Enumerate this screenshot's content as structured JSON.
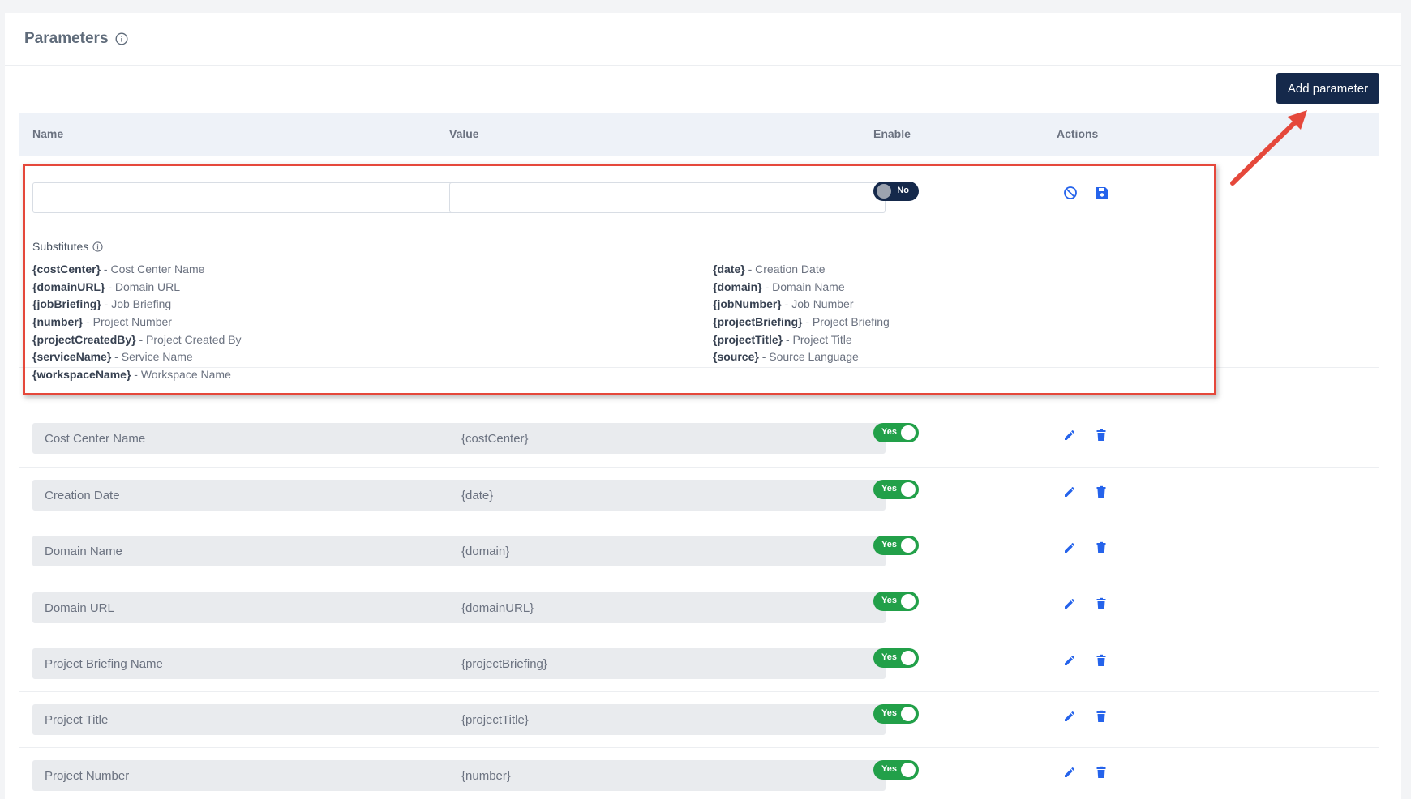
{
  "section": {
    "title": "Parameters"
  },
  "toolbar": {
    "add_label": "Add parameter"
  },
  "table": {
    "columns": {
      "name": "Name",
      "value": "Value",
      "enable": "Enable",
      "actions": "Actions"
    }
  },
  "new_row": {
    "name_value": "",
    "value_value": "",
    "toggle_label": "No",
    "substitutes_title": "Substitutes",
    "substitutes_left": [
      {
        "token": "{costCenter}",
        "desc": " - Cost Center Name"
      },
      {
        "token": "{domainURL}",
        "desc": " - Domain URL"
      },
      {
        "token": "{jobBriefing}",
        "desc": " - Job Briefing"
      },
      {
        "token": "{number}",
        "desc": " - Project Number"
      },
      {
        "token": "{projectCreatedBy}",
        "desc": " - Project Created By"
      },
      {
        "token": "{serviceName}",
        "desc": " - Service Name"
      },
      {
        "token": "{workspaceName}",
        "desc": " - Workspace Name"
      }
    ],
    "substitutes_right": [
      {
        "token": "{date}",
        "desc": " - Creation Date"
      },
      {
        "token": "{domain}",
        "desc": " - Domain Name"
      },
      {
        "token": "{jobNumber}",
        "desc": " - Job Number"
      },
      {
        "token": "{projectBriefing}",
        "desc": " - Project Briefing"
      },
      {
        "token": "{projectTitle}",
        "desc": " - Project Title"
      },
      {
        "token": "{source}",
        "desc": " - Source Language"
      }
    ]
  },
  "rows": [
    {
      "name": "Cost Center Name",
      "value": "{costCenter}",
      "toggle_label": "Yes"
    },
    {
      "name": "Creation Date",
      "value": "{date}",
      "toggle_label": "Yes"
    },
    {
      "name": "Domain Name",
      "value": "{domain}",
      "toggle_label": "Yes"
    },
    {
      "name": "Domain URL",
      "value": "{domainURL}",
      "toggle_label": "Yes"
    },
    {
      "name": "Project Briefing Name",
      "value": "{projectBriefing}",
      "toggle_label": "Yes"
    },
    {
      "name": "Project Title",
      "value": "{projectTitle}",
      "toggle_label": "Yes"
    },
    {
      "name": "Project Number",
      "value": "{number}",
      "toggle_label": "Yes"
    }
  ],
  "colors": {
    "primary_dark": "#15294b",
    "enabled_green": "#22a049",
    "action_blue": "#2563eb",
    "highlight_red": "#e5483b"
  },
  "icons": {
    "info": "info-circle-icon",
    "cancel": "ban-icon",
    "save": "floppy-disk-icon",
    "edit": "pencil-icon",
    "delete": "trash-icon"
  }
}
